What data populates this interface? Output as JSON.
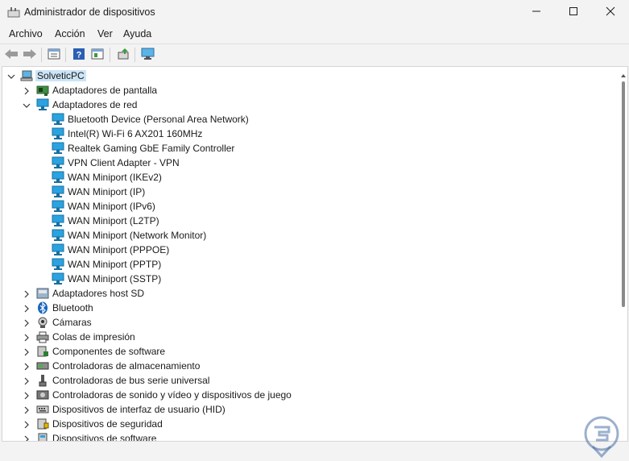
{
  "window": {
    "title": "Administrador de dispositivos",
    "minimize_icon": "minimize-icon",
    "maximize_icon": "maximize-icon",
    "close_icon": "close-icon"
  },
  "menu": {
    "items": [
      "Archivo",
      "Acción",
      "Ver",
      "Ayuda"
    ]
  },
  "toolbar": {
    "buttons": [
      "back-arrow-icon",
      "forward-arrow-icon",
      "properties-icon",
      "help-icon",
      "view-icon",
      "update-driver-icon",
      "monitor-scan-icon"
    ]
  },
  "tree": {
    "root": "SolveticPC",
    "categories": [
      {
        "label": "Adaptadores de pantalla",
        "expanded": false,
        "icon": "display-adapter-icon"
      },
      {
        "label": "Adaptadores de red",
        "expanded": true,
        "icon": "network-adapter-icon",
        "children": [
          "Bluetooth Device (Personal Area Network)",
          "Intel(R) Wi-Fi 6 AX201 160MHz",
          "Realtek Gaming GbE Family Controller",
          "VPN Client Adapter - VPN",
          "WAN Miniport (IKEv2)",
          "WAN Miniport (IP)",
          "WAN Miniport (IPv6)",
          "WAN Miniport (L2TP)",
          "WAN Miniport (Network Monitor)",
          "WAN Miniport (PPPOE)",
          "WAN Miniport (PPTP)",
          "WAN Miniport (SSTP)"
        ]
      },
      {
        "label": "Adaptadores host SD",
        "expanded": false,
        "icon": "sd-host-icon"
      },
      {
        "label": "Bluetooth",
        "expanded": false,
        "icon": "bluetooth-icon"
      },
      {
        "label": "Cámaras",
        "expanded": false,
        "icon": "camera-icon"
      },
      {
        "label": "Colas de impresión",
        "expanded": false,
        "icon": "printer-icon"
      },
      {
        "label": "Componentes de software",
        "expanded": false,
        "icon": "software-component-icon"
      },
      {
        "label": "Controladoras de almacenamiento",
        "expanded": false,
        "icon": "storage-controller-icon"
      },
      {
        "label": "Controladoras de bus serie universal",
        "expanded": false,
        "icon": "usb-icon"
      },
      {
        "label": "Controladoras de sonido y vídeo y dispositivos de juego",
        "expanded": false,
        "icon": "sound-icon"
      },
      {
        "label": "Dispositivos de interfaz de usuario (HID)",
        "expanded": false,
        "icon": "hid-icon"
      },
      {
        "label": "Dispositivos de seguridad",
        "expanded": false,
        "icon": "security-device-icon"
      },
      {
        "label": "Dispositivos de software",
        "expanded": false,
        "icon": "software-device-icon"
      }
    ]
  },
  "colors": {
    "network_icon": "#1e88c8",
    "selection": "#cce4f7",
    "watermark": "#4a6fa5"
  }
}
